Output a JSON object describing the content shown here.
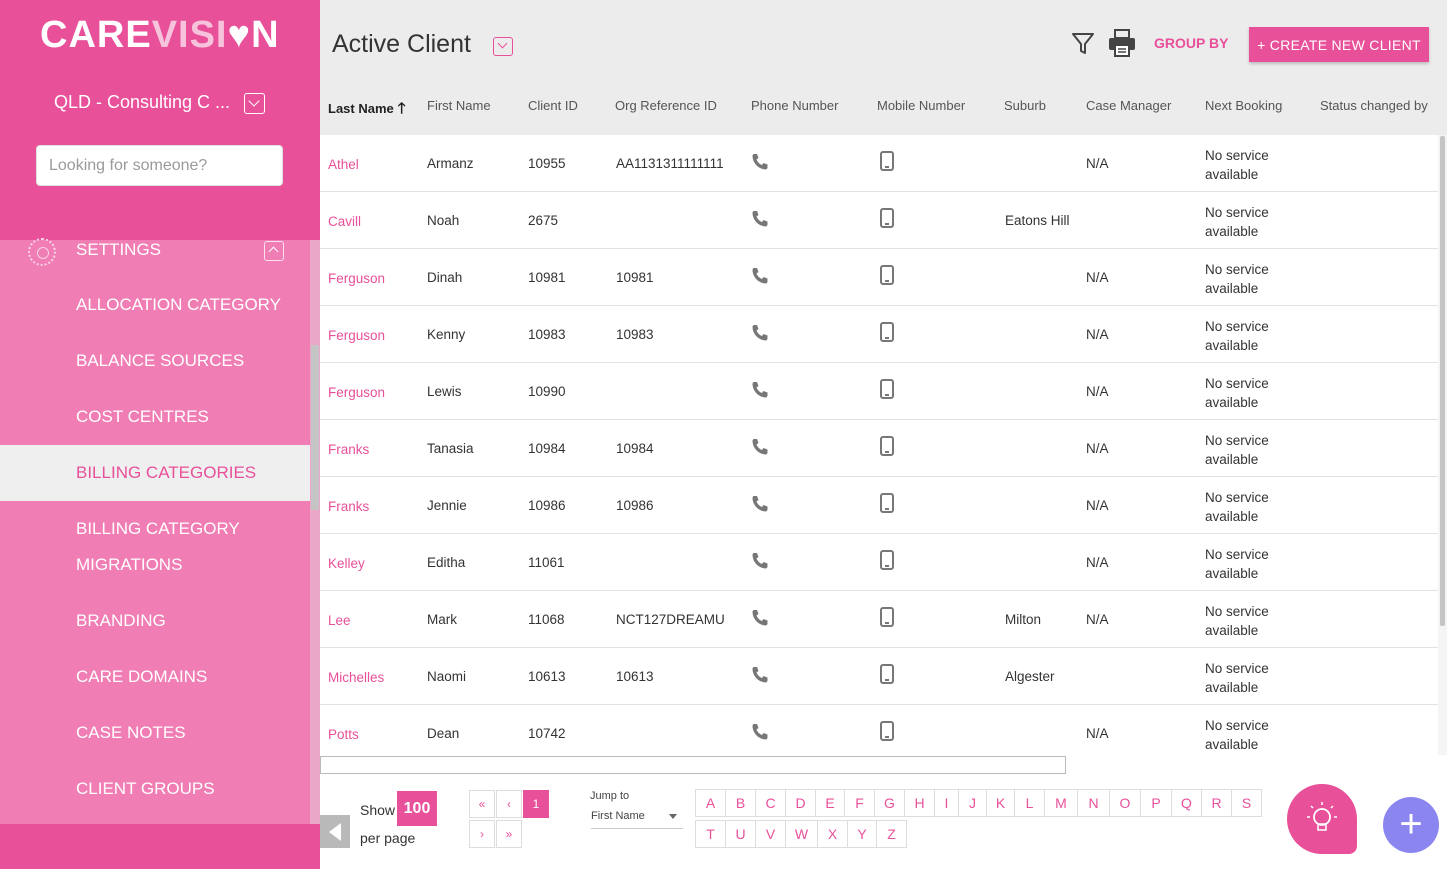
{
  "brand": {
    "logo_part1": "CARE",
    "logo_part2": "VISI",
    "logo_heart": "♥",
    "logo_part3": "N",
    "accent": "#e8509a",
    "sidebar_bg": "#e8509a",
    "menu_bg": "#f07db3"
  },
  "sidebar": {
    "org_name": "QLD - Consulting C ...",
    "search_placeholder": "Looking for someone?",
    "section_label": "SETTINGS",
    "items": [
      {
        "label": "ALLOCATION CATEGORY",
        "active": false
      },
      {
        "label": "BALANCE SOURCES",
        "active": false
      },
      {
        "label": "COST CENTRES",
        "active": false
      },
      {
        "label": "BILLING CATEGORIES",
        "active": true
      },
      {
        "label": "BILLING CATEGORY",
        "label2": "MIGRATIONS",
        "active": false
      },
      {
        "label": "BRANDING",
        "active": false
      },
      {
        "label": "CARE DOMAINS",
        "active": false
      },
      {
        "label": "CASE NOTES",
        "active": false
      },
      {
        "label": "CLIENT GROUPS",
        "active": false
      }
    ]
  },
  "header": {
    "title": "Active Client",
    "group_by": "GROUP BY",
    "create_button": "+ CREATE NEW CLIENT"
  },
  "table": {
    "columns": [
      "Last Name",
      "First Name",
      "Client ID",
      "Org Reference ID",
      "Phone Number",
      "Mobile Number",
      "Suburb",
      "Case Manager",
      "Next Booking",
      "Status changed by"
    ],
    "sort_arrow": "🡑",
    "rows": [
      {
        "last": "Athel",
        "first": "Armanz",
        "id": "10955",
        "org_ref": "AA1131311111111",
        "suburb": "",
        "case_manager": "N/A",
        "next": "No service available"
      },
      {
        "last": "Cavill",
        "first": "Noah",
        "id": "2675",
        "org_ref": "",
        "suburb": "Eatons Hill",
        "case_manager": "",
        "next": "No service available"
      },
      {
        "last": "Ferguson",
        "first": "Dinah",
        "id": "10981",
        "org_ref": "10981",
        "suburb": "",
        "case_manager": "N/A",
        "next": "No service available"
      },
      {
        "last": "Ferguson",
        "first": "Kenny",
        "id": "10983",
        "org_ref": "10983",
        "suburb": "",
        "case_manager": "N/A",
        "next": "No service available"
      },
      {
        "last": "Ferguson",
        "first": "Lewis",
        "id": "10990",
        "org_ref": "",
        "suburb": "",
        "case_manager": "N/A",
        "next": "No service available"
      },
      {
        "last": "Franks",
        "first": "Tanasia",
        "id": "10984",
        "org_ref": "10984",
        "suburb": "",
        "case_manager": "N/A",
        "next": "No service available"
      },
      {
        "last": "Franks",
        "first": "Jennie",
        "id": "10986",
        "org_ref": "10986",
        "suburb": "",
        "case_manager": "N/A",
        "next": "No service available"
      },
      {
        "last": "Kelley",
        "first": "Editha",
        "id": "11061",
        "org_ref": "",
        "suburb": "",
        "case_manager": "N/A",
        "next": "No service available"
      },
      {
        "last": "Lee",
        "first": "Mark",
        "id": "11068",
        "org_ref": "NCT127DREAMU",
        "suburb": "Milton",
        "case_manager": "N/A",
        "next": "No service available"
      },
      {
        "last": "Michelles",
        "first": "Naomi",
        "id": "10613",
        "org_ref": "10613",
        "suburb": "Algester",
        "case_manager": "",
        "next": "No service available"
      },
      {
        "last": "Potts",
        "first": "Dean",
        "id": "10742",
        "org_ref": "",
        "suburb": "",
        "case_manager": "N/A",
        "next": "No service available"
      }
    ]
  },
  "pagination": {
    "show_label": "Show",
    "per_page": "100",
    "per_page_label": "per page",
    "first": "«",
    "prev": "‹",
    "current": "1",
    "next": "›",
    "last": "»",
    "jump_label": "Jump to",
    "jump_value": "First Name",
    "letters": [
      "A",
      "B",
      "C",
      "D",
      "E",
      "F",
      "G",
      "H",
      "I",
      "J",
      "K",
      "L",
      "M",
      "N",
      "O",
      "P",
      "Q",
      "R",
      "S",
      "T",
      "U",
      "V",
      "W",
      "X",
      "Y",
      "Z"
    ]
  },
  "fab_label": "+"
}
